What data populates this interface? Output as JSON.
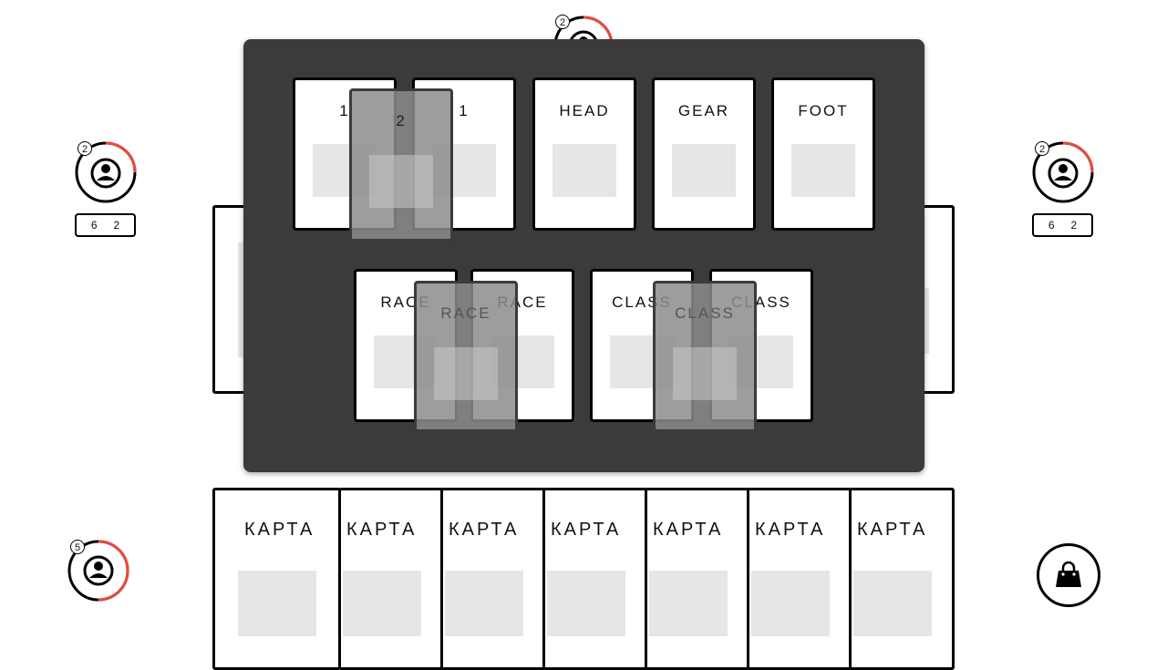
{
  "players": {
    "top": {
      "level": "2",
      "progress": 0.25
    },
    "left": {
      "level": "2",
      "progress": 0.25,
      "stat_a": "6",
      "stat_b": "2"
    },
    "right": {
      "level": "2",
      "progress": 0.25,
      "stat_a": "6",
      "stat_b": "2"
    },
    "me": {
      "level": "5",
      "progress": 0.5
    }
  },
  "equipment": {
    "row1": [
      "1",
      "1",
      "HEAD",
      "GEAR",
      "FOOT"
    ],
    "row1_ghost": "2",
    "row2": [
      "RACE",
      "RACE",
      "CLASS",
      "CLASS"
    ],
    "row2_ghosts": [
      "RACE",
      "CLASS"
    ]
  },
  "hand": {
    "cards": [
      "КАРТА",
      "КАРТА",
      "КАРТА",
      "КАРТА",
      "КАРТА",
      "КАРТА",
      "КАРТА"
    ]
  },
  "colors": {
    "progress": "#e74c3c",
    "modal_bg": "#3b3b3b",
    "art_placeholder": "#e6e6e6"
  },
  "icons": {
    "player": "user-circle-icon",
    "shop": "shopping-bag-icon"
  }
}
